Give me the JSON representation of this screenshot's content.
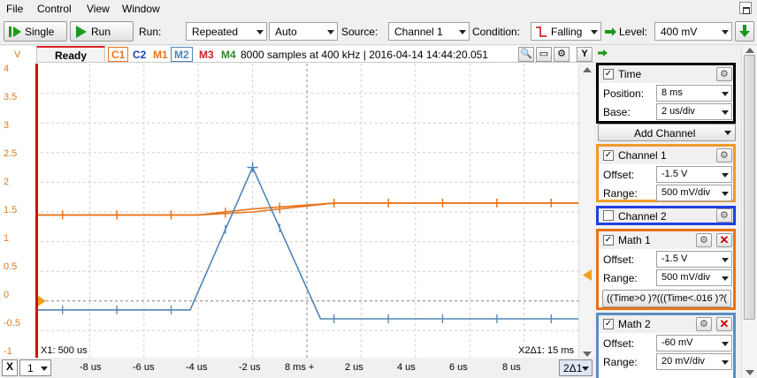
{
  "menu": {
    "items": [
      "File",
      "Control",
      "View",
      "Window"
    ]
  },
  "toolbar": {
    "single_label": "Single",
    "run_label": "Run",
    "run_mode_label": "Run:",
    "run_mode_value": "Repeated",
    "auto_value": "Auto",
    "source_label": "Source:",
    "source_value": "Channel 1",
    "condition_label": "Condition:",
    "condition_value": "Falling",
    "level_label": "Level:",
    "level_value": "400 mV"
  },
  "scope": {
    "status": "Ready",
    "chips": [
      "C1",
      "C2",
      "M1",
      "M2",
      "M3",
      "M4"
    ],
    "info": "8000 samples at 400 kHz | 2016-04-14 14:44:20.051",
    "y_unit": "V",
    "y_ticks": [
      "4",
      "3.5",
      "3",
      "2.5",
      "2",
      "1.5",
      "1",
      "0.5",
      "0",
      "-0.5",
      "-1"
    ],
    "x_ticks": [
      "-8 us",
      "-6 us",
      "-4 us",
      "-2 us",
      "8 ms +",
      "2 us",
      "4 us",
      "6 us",
      "8 us"
    ],
    "x1_readout": "X1: 500 us",
    "x2_readout": "X2Δ1: 15 ms",
    "x_axis_button": "X",
    "x_axis_select": "1",
    "delta_button": "2Δ1",
    "y_button": "Y"
  },
  "colors": {
    "channel1": "#e8731a",
    "channel2": "#1f3fbf",
    "math1": "#e8731a",
    "math2": "#4f86b8",
    "trigger": "#cc1111",
    "time_border": "#000000"
  },
  "chart_data": {
    "type": "line",
    "xlabel": "",
    "ylabel": "V",
    "x_unit": "us",
    "xlim": [
      -10,
      10
    ],
    "ylim": [
      -1,
      4
    ],
    "grid": true,
    "series": [
      {
        "name": "C1",
        "color": "#e8731a",
        "x": [
          -10,
          -4,
          -2,
          1,
          10
        ],
        "y": [
          1.45,
          1.45,
          1.5,
          1.65,
          1.65
        ]
      },
      {
        "name": "M1",
        "color": "#e8731a",
        "x": [
          -10,
          -4,
          -2,
          1,
          10
        ],
        "y": [
          1.45,
          1.45,
          1.55,
          1.65,
          1.65
        ]
      },
      {
        "name": "M2",
        "color": "#4f86b8",
        "x": [
          -10,
          -4.3,
          -2,
          0.5,
          10
        ],
        "y": [
          -0.15,
          -0.15,
          2.25,
          -0.3,
          -0.3
        ]
      }
    ]
  },
  "side": {
    "time": {
      "title": "Time",
      "position_label": "Position:",
      "position_value": "8 ms",
      "base_label": "Base:",
      "base_value": "2 us/div"
    },
    "add_channel_label": "Add Channel",
    "channel1": {
      "title": "Channel 1",
      "offset_label": "Offset:",
      "offset_value": "-1.5 V",
      "range_label": "Range:",
      "range_value": "500 mV/div"
    },
    "channel2": {
      "title": "Channel 2"
    },
    "math1": {
      "title": "Math 1",
      "offset_label": "Offset:",
      "offset_value": "-1.5 V",
      "range_label": "Range:",
      "range_value": "500 mV/div",
      "expression": "((Time>0 )?(((Time<.016 )?("
    },
    "math2": {
      "title": "Math 2",
      "offset_label": "Offset:",
      "offset_value": "-60 mV",
      "range_label": "Range:",
      "range_value": "20 mV/div"
    }
  }
}
